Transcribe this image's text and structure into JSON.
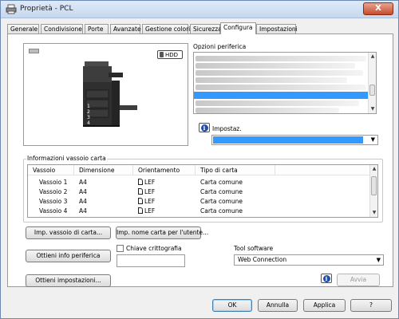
{
  "window": {
    "title": "Proprietà - PCL",
    "close_label": "X"
  },
  "tabs": [
    {
      "label": "Generale"
    },
    {
      "label": "Condivisione"
    },
    {
      "label": "Porte"
    },
    {
      "label": "Avanzate"
    },
    {
      "label": "Gestione colori"
    },
    {
      "label": "Sicurezza"
    },
    {
      "label": "Configura",
      "active": true
    },
    {
      "label": "Impostazioni"
    }
  ],
  "preview": {
    "badge": "HDD",
    "tray_numbers": [
      "1",
      "2",
      "3",
      "4"
    ]
  },
  "options": {
    "label": "Opzioni periferica",
    "selected_index": 7,
    "row_count": 9
  },
  "setting": {
    "label": "Impostaz.",
    "value": ""
  },
  "paper_tray": {
    "label": "Informazioni vassoio carta",
    "columns": [
      "Vassoio",
      "Dimensione",
      "Orientamento",
      "Tipo di carta"
    ],
    "rows": [
      {
        "tray": "Vassoio 1",
        "size": "A4",
        "orientation": "LEF",
        "type": "Carta comune"
      },
      {
        "tray": "Vassoio 2",
        "size": "A4",
        "orientation": "LEF",
        "type": "Carta comune"
      },
      {
        "tray": "Vassoio 3",
        "size": "A4",
        "orientation": "LEF",
        "type": "Carta comune"
      },
      {
        "tray": "Vassoio 4",
        "size": "A4",
        "orientation": "LEF",
        "type": "Carta comune"
      }
    ]
  },
  "buttons": {
    "tray_settings": "Imp. vassoio di carta...",
    "paper_name": "Imp. nome carta per l'utente...",
    "get_device_info": "Ottieni info periferica",
    "get_settings": "Ottieni impostazioni...",
    "launch": "Avvia",
    "ok": "OK",
    "cancel": "Annulla",
    "apply": "Applica",
    "help": "?"
  },
  "encryption": {
    "label": "Chiave crittografia",
    "checked": false,
    "value": ""
  },
  "tool_software": {
    "label": "Tool software",
    "value": "Web Connection"
  },
  "colors": {
    "selection": "#3399ff",
    "panel_border": "#9a9a9a",
    "title_bar": "#c6d8ef"
  }
}
